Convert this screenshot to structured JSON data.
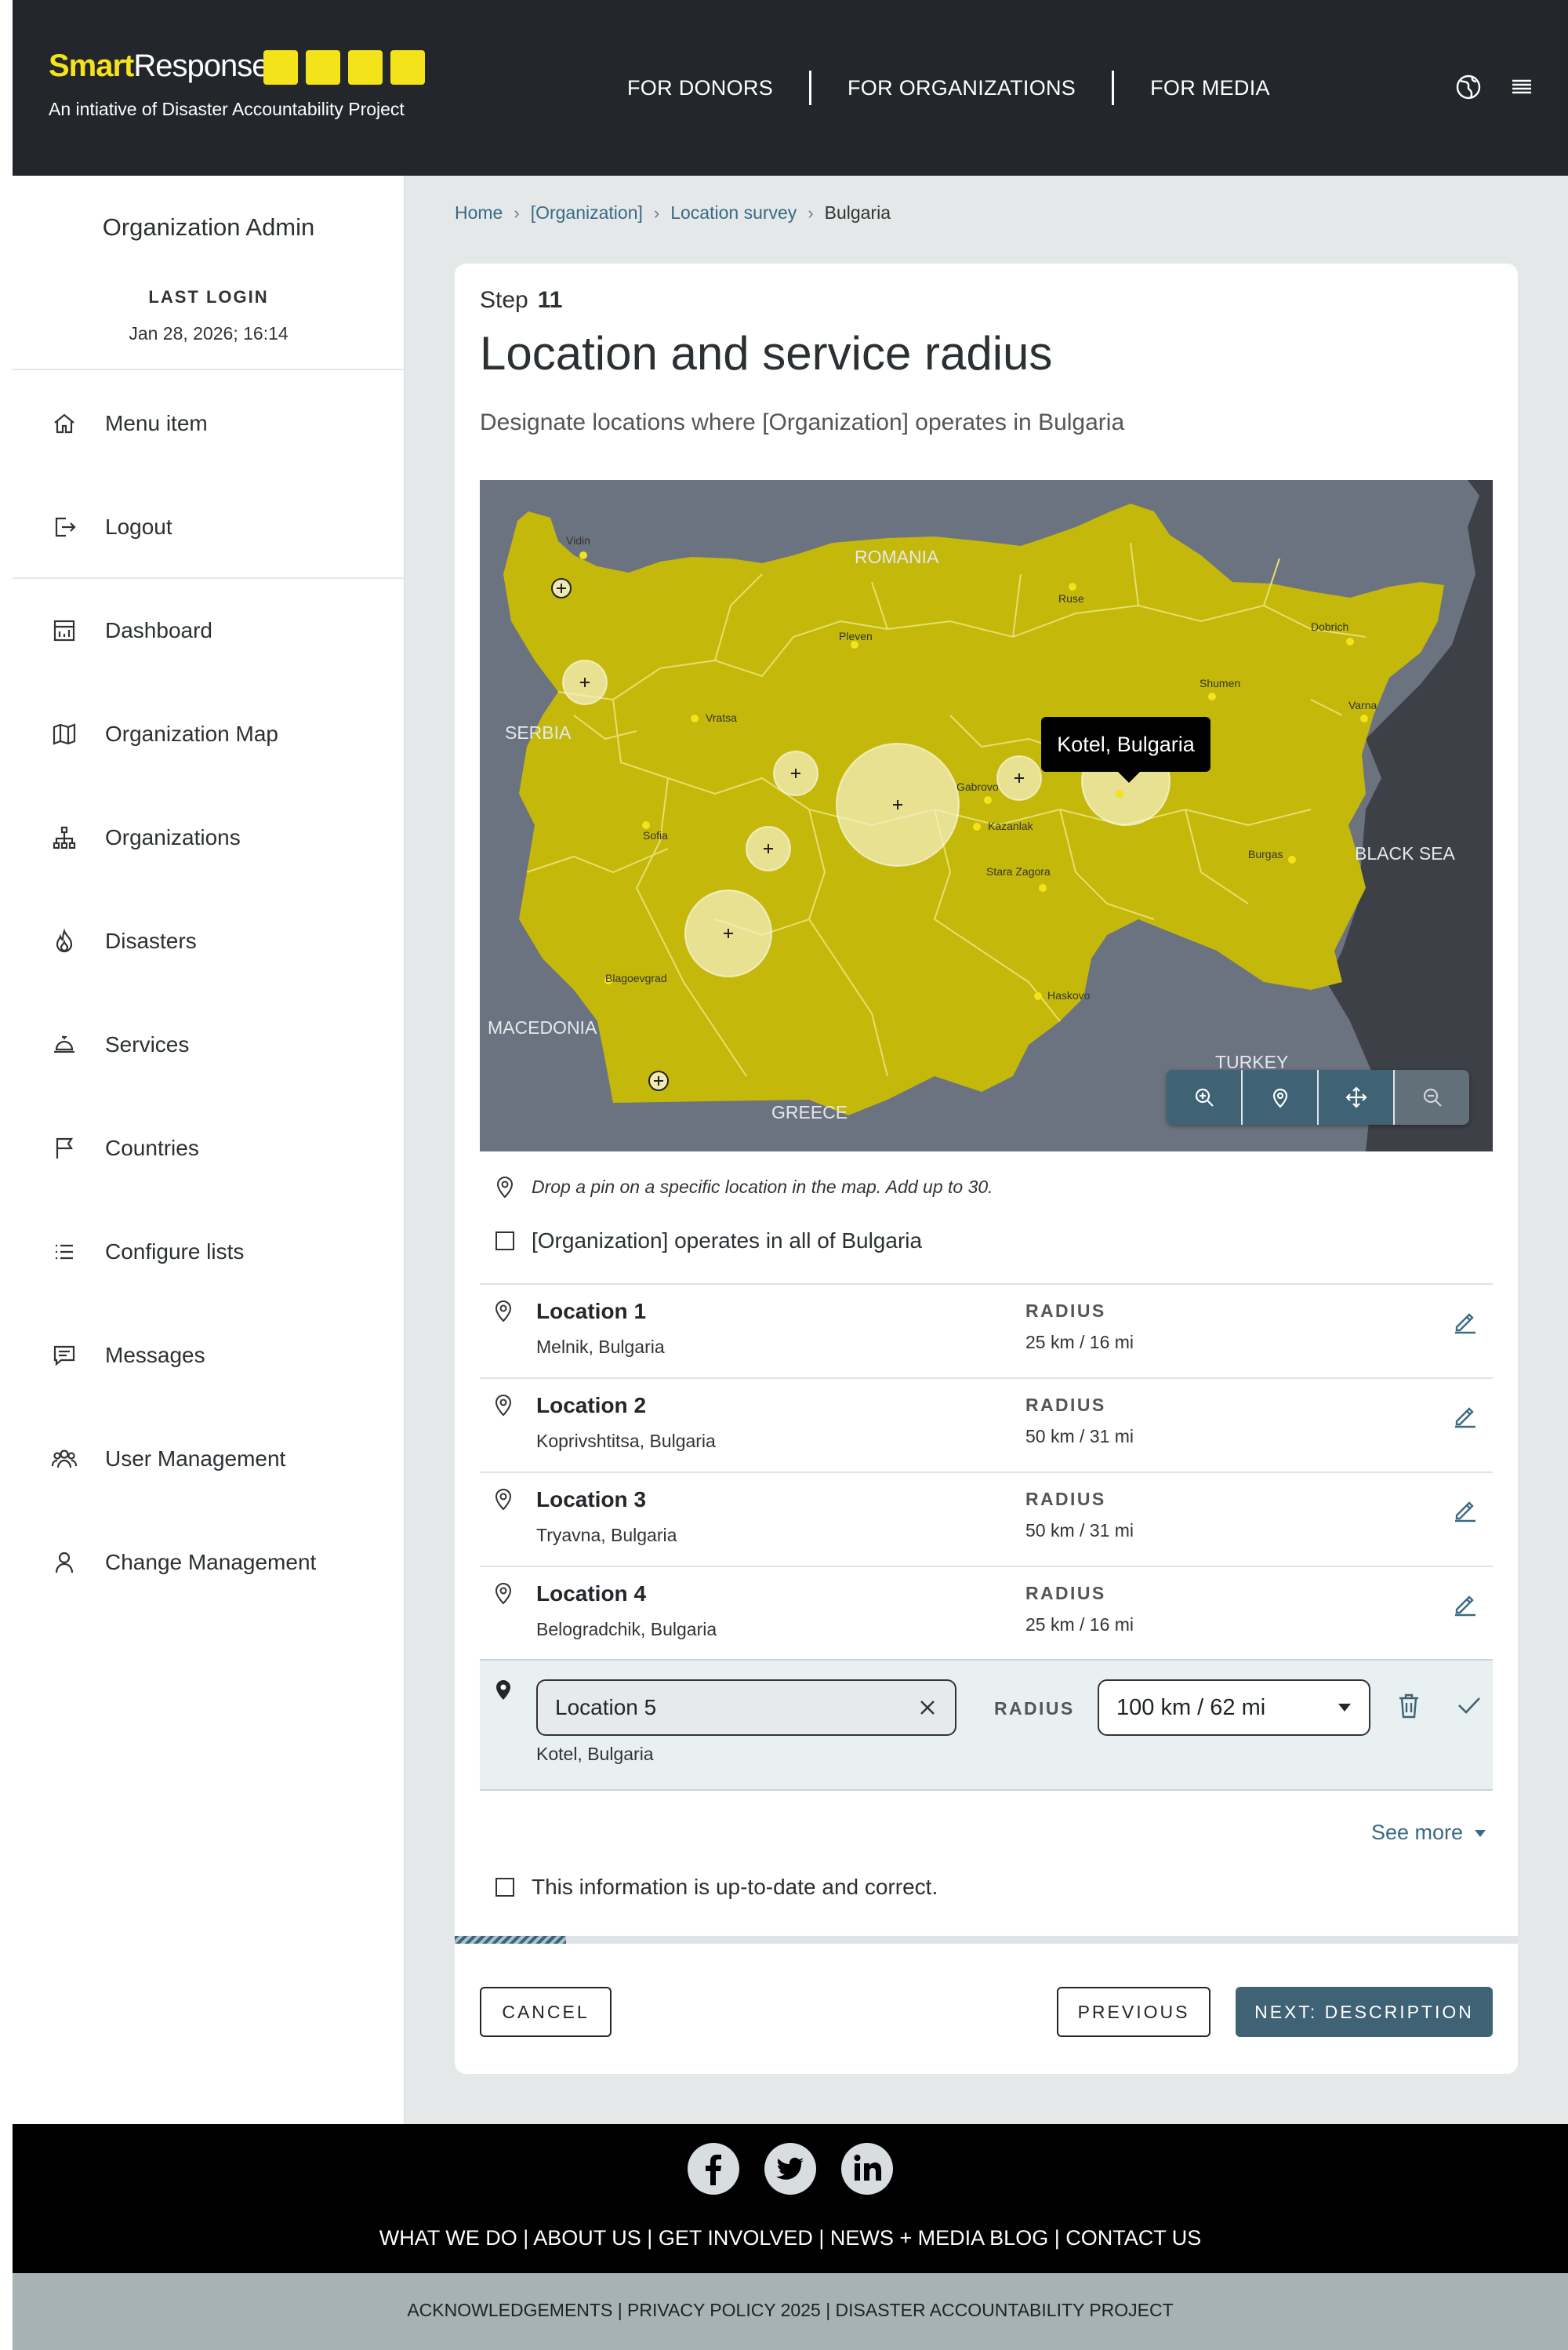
{
  "header": {
    "brand_part1": "Smart",
    "brand_part2": "Response",
    "tagline": "An intiative of Disaster Accountability Project",
    "nav": [
      "FOR DONORS",
      "FOR ORGANIZATIONS",
      "FOR MEDIA"
    ],
    "accent_color": "#f4e21b"
  },
  "sidebar": {
    "title": "Organization Admin",
    "last_login_label": "LAST LOGIN",
    "last_login_value": "Jan 28, 2026; 16:14",
    "items": [
      {
        "label": "Menu item",
        "icon": "home-icon"
      },
      {
        "label": "Logout",
        "icon": "logout-icon"
      },
      {
        "label": "Dashboard",
        "icon": "dashboard-icon"
      },
      {
        "label": "Organization Map",
        "icon": "map-icon"
      },
      {
        "label": "Organizations",
        "icon": "hierarchy-icon"
      },
      {
        "label": "Disasters",
        "icon": "fire-icon"
      },
      {
        "label": "Services",
        "icon": "service-bell-icon"
      },
      {
        "label": "Countries",
        "icon": "flag-icon"
      },
      {
        "label": "Configure lists",
        "icon": "list-icon"
      },
      {
        "label": "Messages",
        "icon": "message-icon"
      },
      {
        "label": "User Management",
        "icon": "users-icon"
      },
      {
        "label": "Change Management",
        "icon": "user-icon"
      }
    ]
  },
  "breadcrumb": [
    "Home",
    "[Organization]",
    "Location survey",
    "Bulgaria"
  ],
  "form": {
    "step_label": "Step",
    "step_number": "11",
    "title": "Location and service radius",
    "subtitle": "Designate locations where [Organization] operates in Bulgaria",
    "map": {
      "labels": {
        "romania": "ROMANIA",
        "serbia": "SERBIA",
        "black_sea": "BLACK SEA",
        "macedonia": "MACEDONIA",
        "turkey": "TURKEY",
        "greece": "GREECE"
      },
      "cities": [
        "Vidin",
        "Ruse",
        "Pleven",
        "Dobrich",
        "Shumen",
        "Varna",
        "Vratsa",
        "Gabrovo",
        "Kazanlak",
        "Sofia",
        "Stara Zagora",
        "Burgas",
        "Blagoevgrad",
        "Haskovo"
      ],
      "tooltip": "Kotel, Bulgaria",
      "controls": [
        "zoom-in-icon",
        "pin-icon",
        "move-icon",
        "zoom-out-icon"
      ],
      "country_color": "#c4b90a"
    },
    "hint": "Drop a pin on a specific location in the map. Add up to 30.",
    "all_country_label": "[Organization] operates in all of Bulgaria",
    "radius_label": "RADIUS",
    "locations": [
      {
        "name": "Location 1",
        "place": "Melnik, Bulgaria",
        "radius": "25 km / 16 mi"
      },
      {
        "name": "Location 2",
        "place": "Koprivshtitsa, Bulgaria",
        "radius": "50 km / 31 mi"
      },
      {
        "name": "Location 3",
        "place": "Tryavna, Bulgaria",
        "radius": "50 km / 31 mi"
      },
      {
        "name": "Location 4",
        "place": "Belogradchik, Bulgaria",
        "radius": "25 km / 16 mi"
      }
    ],
    "editing": {
      "name_value": "Location 5",
      "place": "Kotel, Bulgaria",
      "radius_value": "100 km / 62 mi"
    },
    "see_more": "See more",
    "confirm_label": "This information is up-to-date and correct.",
    "progress_fraction": 0.105,
    "buttons": {
      "cancel": "CANCEL",
      "previous": "PREVIOUS",
      "next": "NEXT: DESCRIPTION"
    }
  },
  "footer": {
    "social": [
      "facebook-icon",
      "twitter-icon",
      "linkedin-icon"
    ],
    "links": "WHAT WE DO | ABOUT US | GET INVOLVED | NEWS + MEDIA BLOG | CONTACT US",
    "legal": "ACKNOWLEDGEMENTS | PRIVACY POLICY 2025 | DISASTER ACCOUNTABILITY PROJECT"
  }
}
